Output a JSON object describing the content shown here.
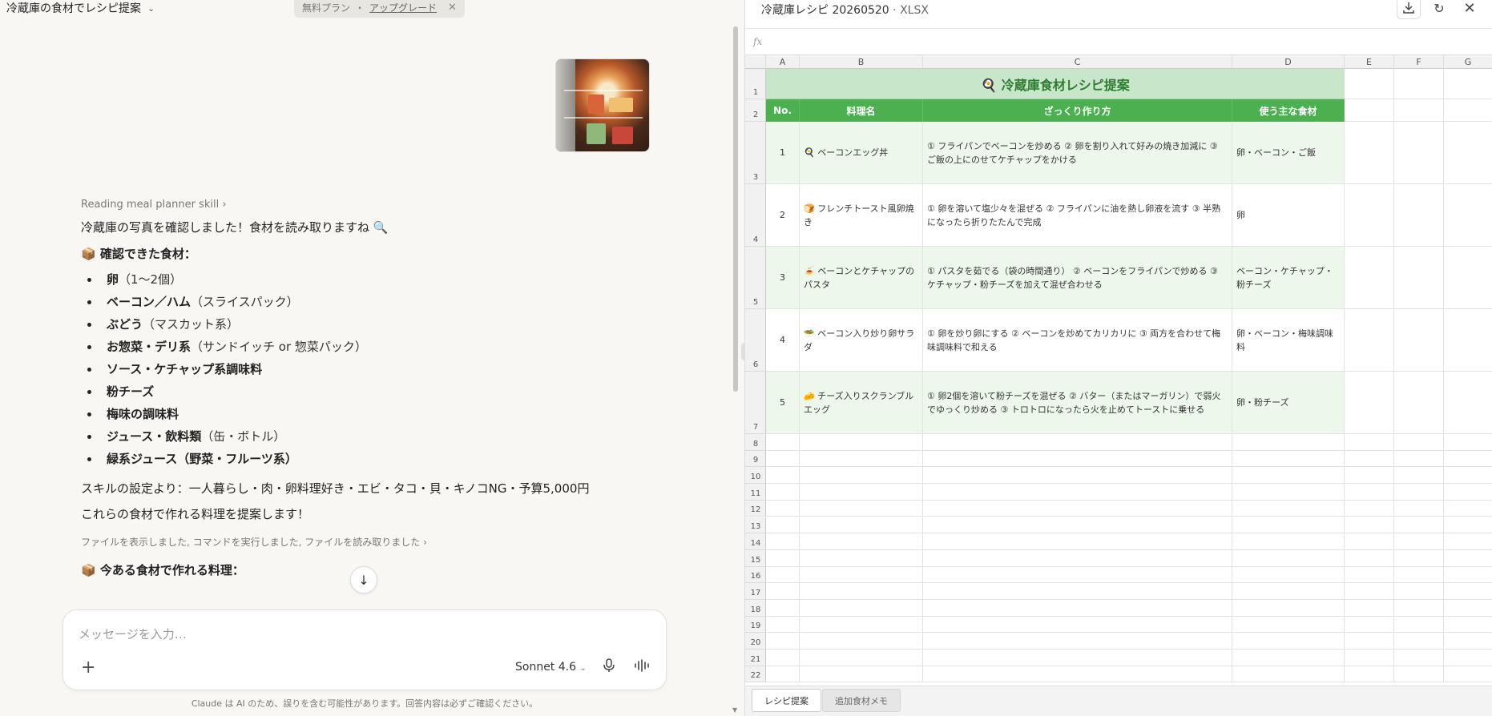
{
  "chat": {
    "title": "冷蔵庫の食材でレシピ提案",
    "plan_label": "無料プラン",
    "plan_sep": "・",
    "upgrade_label": "アップグレード",
    "skill_link": "Reading meal planner skill",
    "intro": "冷蔵庫の写真を確認しました！食材を読み取りますね 🔍",
    "foods_heading": "📦 確認できた食材：",
    "foods": [
      {
        "name": "卵",
        "note": "（1〜2個）"
      },
      {
        "name": "ベーコン／ハム",
        "note": "（スライスパック）"
      },
      {
        "name": "ぶどう",
        "note": "（マスカット系）"
      },
      {
        "name": "お惣菜・デリ系",
        "note": "（サンドイッチ or 惣菜パック）"
      },
      {
        "name": "ソース・ケチャップ系調味料",
        "note": ""
      },
      {
        "name": "粉チーズ",
        "note": ""
      },
      {
        "name": "梅味の調味料",
        "note": ""
      },
      {
        "name": "ジュース・飲料類",
        "note": "（缶・ボトル）"
      },
      {
        "name": "緑系ジュース（野菜・フルーツ系）",
        "note": ""
      }
    ],
    "skill_settings": "スキルの設定より：一人暮らし・肉・卵料理好き・エビ・タコ・貝・キノコNG・予算5,000円",
    "propose": "これらの食材で作れる料理を提案します！",
    "tool_line": "ファイルを表示しました, コマンドを実行しました, ファイルを読み取りました",
    "next_heading": "📦 今ある食材で作れる料理：",
    "composer_placeholder": "メッセージを入力…",
    "model": "Sonnet 4.6",
    "disclaimer": "Claude は AI のため、誤りを含む可能性があります。回答内容は必ずご確認ください。"
  },
  "sheet": {
    "file_name": "冷蔵庫レシピ 20260520",
    "file_ext": " · XLSX",
    "fx_label": "fx",
    "columns": [
      "A",
      "B",
      "C",
      "D",
      "E",
      "F",
      "G"
    ],
    "title": "🍳 冷蔵庫食材レシピ提案",
    "headers": [
      "No.",
      "料理名",
      "ざっくり作り方",
      "使う主な食材"
    ],
    "rows": [
      {
        "no": "1",
        "dish": "🍳 ベーコンエッグ丼",
        "how": "① フライパンでベーコンを炒める ② 卵を割り入れて好みの焼き加減に ③ ご飯の上にのせてケチャップをかける",
        "ingredients": "卵・ベーコン・ご飯"
      },
      {
        "no": "2",
        "dish": "🍞 フレンチトースト風卵焼き",
        "how": "① 卵を溶いて塩少々を混ぜる ② フライパンに油を熱し卵液を流す ③ 半熟になったら折りたたんで完成",
        "ingredients": "卵"
      },
      {
        "no": "3",
        "dish": "🍝 ベーコンとケチャップのパスタ",
        "how": "① パスタを茹でる（袋の時間通り） ② ベーコンをフライパンで炒める ③ ケチャップ・粉チーズを加えて混ぜ合わせる",
        "ingredients": "ベーコン・ケチャップ・粉チーズ"
      },
      {
        "no": "4",
        "dish": "🥗 ベーコン入り炒り卵サラダ",
        "how": "① 卵を炒り卵にする ② ベーコンを炒めてカリカリに ③ 両方を合わせて梅味調味料で和える",
        "ingredients": "卵・ベーコン・梅味調味料"
      },
      {
        "no": "5",
        "dish": "🧀 チーズ入りスクランブルエッグ",
        "how": "① 卵2個を溶いて粉チーズを混ぜる ② バター（またはマーガリン）で弱火でゆっくり炒める ③ トロトロになったら火を止めてトーストに乗せる",
        "ingredients": "卵・粉チーズ"
      }
    ],
    "tabs": [
      "レシピ提案",
      "追加食材メモ"
    ]
  },
  "colors": {
    "title_bg": "#c8e6c9",
    "header_bg": "#4caf50",
    "row_alt_bg": "#eef7ec",
    "title_text": "#2e7d32"
  },
  "icons": [
    "chevron-down-icon",
    "close-icon",
    "scroll-down-arrow-icon",
    "plus-icon",
    "mic-icon",
    "voice-waveform-icon",
    "download-icon",
    "refresh-icon"
  ]
}
